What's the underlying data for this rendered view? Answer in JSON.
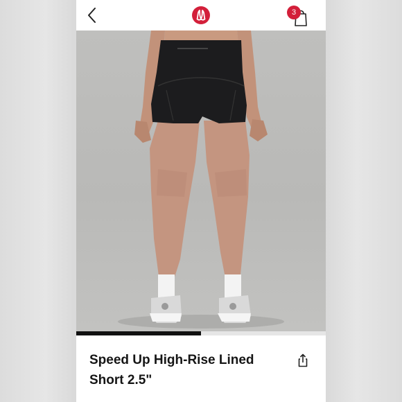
{
  "header": {
    "back_icon": "chevron-left-icon",
    "logo": "lululemon-logo",
    "cart_icon": "shopping-bag-icon",
    "cart_count": "3",
    "brand_color": "#d31f3a"
  },
  "gallery": {
    "image": "back-view-model-black-shorts",
    "progress": 0.5
  },
  "product": {
    "title_line1": "Speed Up High-Rise Lined",
    "title_line2": "Short 2.5\"",
    "share_icon": "share-icon"
  }
}
